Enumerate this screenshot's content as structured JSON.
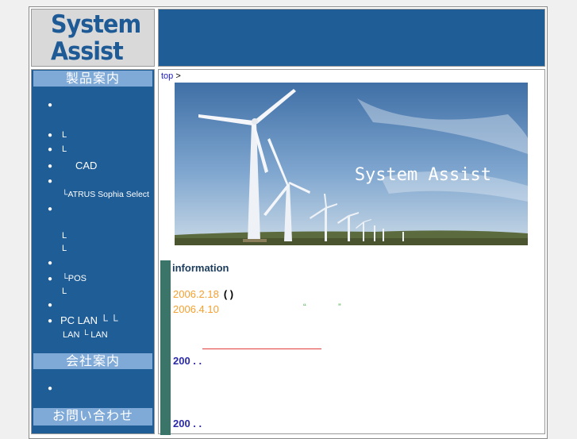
{
  "logo": {
    "line1": "System",
    "line2": "Assist"
  },
  "breadcrumb": {
    "link": "top",
    "separator": ">"
  },
  "sidebar": {
    "products_heading": "製品案内",
    "company_heading": "会社案内",
    "contact_heading": "お問い合わせ",
    "items": [
      {
        "bullet": "●",
        "text": ""
      },
      {
        "bullet": "●",
        "text": "L"
      },
      {
        "bullet": "●",
        "text": "L"
      },
      {
        "bullet": "●",
        "text": "CAD"
      },
      {
        "bullet": "●",
        "text": ""
      },
      {
        "bullet": "",
        "text": "└ATRUS Sophia Select"
      },
      {
        "bullet": "●",
        "text": ""
      },
      {
        "bullet": "",
        "text": "L"
      },
      {
        "bullet": "",
        "text": "L"
      },
      {
        "bullet": "●",
        "text": ""
      },
      {
        "bullet": "●",
        "text": "└POS"
      },
      {
        "bullet": "",
        "text": "L"
      },
      {
        "bullet": "●",
        "text": ""
      },
      {
        "bullet": "●",
        "text": "PC  LAN └    └"
      },
      {
        "bullet": "",
        "text": "LAN  └  LAN"
      },
      {
        "bullet": "●",
        "text": ""
      }
    ]
  },
  "hero": {
    "caption": "System Assist"
  },
  "information": {
    "title": "information",
    "news": [
      {
        "date": "2006.2.18",
        "text": "( )"
      },
      {
        "date": "2006.4.10",
        "text": ""
      }
    ],
    "quote_open": "“",
    "quote_close": "”",
    "notes": [
      "200 . .",
      "200 . ."
    ]
  },
  "colors": {
    "brand_blue": "#1f5d97",
    "section_head": "#7fa9d6",
    "date_orange": "#f5a030",
    "info_bar": "#3b7468",
    "note_blue": "#2a2aa8"
  }
}
